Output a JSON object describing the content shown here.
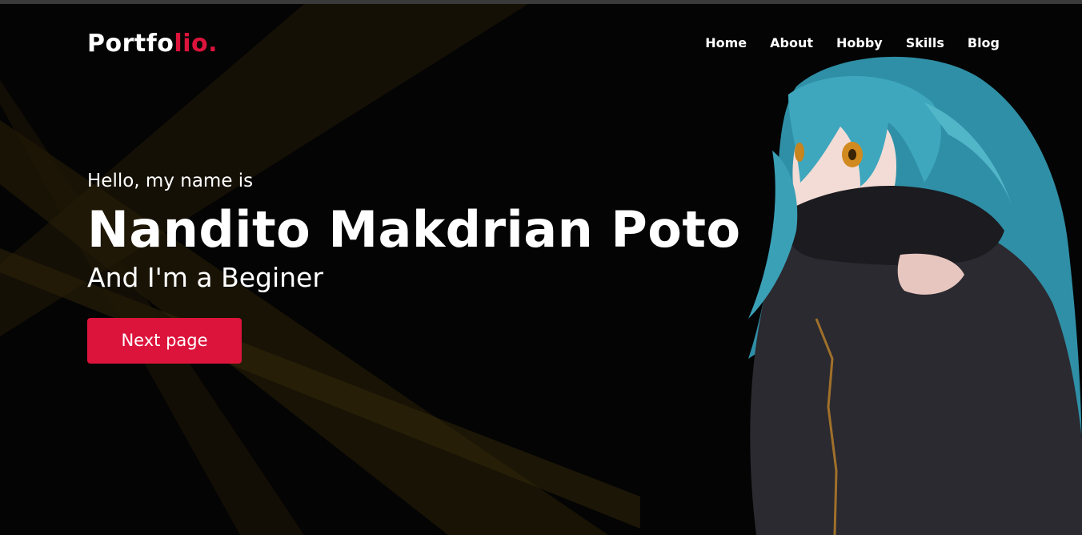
{
  "logo": {
    "main": "Portfo",
    "accent": "lio."
  },
  "nav": {
    "items": [
      {
        "label": "Home"
      },
      {
        "label": "About"
      },
      {
        "label": "Hobby"
      },
      {
        "label": "Skills"
      },
      {
        "label": "Blog"
      }
    ]
  },
  "hero": {
    "greeting": "Hello, my name is",
    "name": "Nandito Makdrian Poto",
    "role": "And I'm a Beginer",
    "button_label": "Next page"
  },
  "colors": {
    "accent": "#dc143c",
    "background": "#040404",
    "text": "#ffffff",
    "hair": "#3ea7bd",
    "coat": "#2b2a30"
  },
  "icons": {
    "character": "anime-character-illustration"
  }
}
